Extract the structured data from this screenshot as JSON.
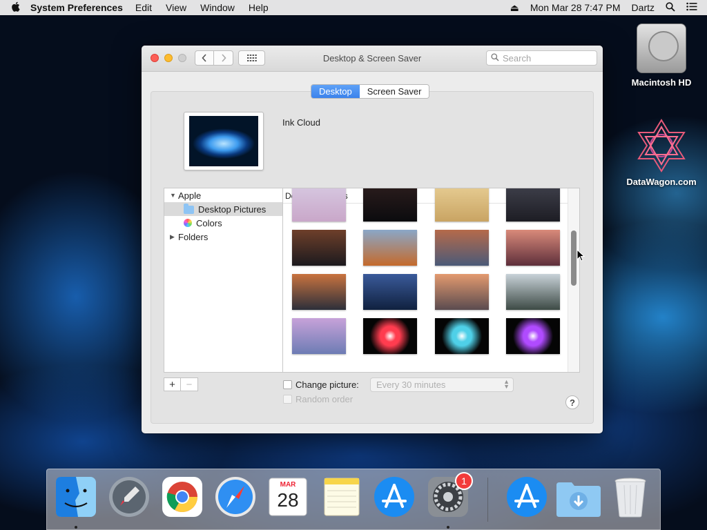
{
  "menubar": {
    "apple": "",
    "app_name": "System Preferences",
    "items": [
      "Edit",
      "View",
      "Window",
      "Help"
    ],
    "eject": "⏏",
    "datetime": "Mon Mar 28  7:47 PM",
    "user": "Dartz"
  },
  "window": {
    "title": "Desktop & Screen Saver",
    "search_placeholder": "Search",
    "tabs": [
      {
        "label": "Desktop",
        "active": true
      },
      {
        "label": "Screen Saver",
        "active": false
      }
    ],
    "current_picture": "Ink Cloud",
    "sources": [
      {
        "label": "Apple",
        "type": "group",
        "expanded": true
      },
      {
        "label": "Desktop Pictures",
        "type": "child",
        "icon": "folder-icon",
        "selected": true
      },
      {
        "label": "Colors",
        "type": "child",
        "icon": "colors-icon"
      },
      {
        "label": "Folders",
        "type": "group",
        "expanded": false
      }
    ],
    "grid_header": "Desktop Pictures",
    "thumbnails": [
      {
        "name": "wallpaper-lake-rock",
        "colors": [
          "#d6c7e0",
          "#c9a7c9"
        ]
      },
      {
        "name": "wallpaper-mono-lake-night",
        "colors": [
          "#2a1c1c",
          "#0b0b0e"
        ]
      },
      {
        "name": "wallpaper-desert-dunes",
        "colors": [
          "#e6cc92",
          "#c9a463"
        ]
      },
      {
        "name": "wallpaper-mojave-dunes",
        "colors": [
          "#3e3f4a",
          "#1d1d24"
        ]
      },
      {
        "name": "wallpaper-sierra-peaks",
        "colors": [
          "#6e3f2a",
          "#1c1a1e"
        ]
      },
      {
        "name": "wallpaper-high-sierra",
        "colors": [
          "#8aa7c7",
          "#c46a2b"
        ]
      },
      {
        "name": "wallpaper-el-capitan-dusk",
        "colors": [
          "#b56a4a",
          "#4b5a78"
        ]
      },
      {
        "name": "wallpaper-sierra-sunset",
        "colors": [
          "#d98a7a",
          "#5e2f3b"
        ]
      },
      {
        "name": "wallpaper-el-capitan",
        "colors": [
          "#c9733f",
          "#2c2f3a"
        ]
      },
      {
        "name": "wallpaper-blue-mountains",
        "colors": [
          "#3a5a9a",
          "#10213f"
        ]
      },
      {
        "name": "wallpaper-half-dome",
        "colors": [
          "#e39a6f",
          "#5a4b4f"
        ]
      },
      {
        "name": "wallpaper-yosemite-forest",
        "colors": [
          "#c8d2d8",
          "#3d4a45"
        ]
      },
      {
        "name": "wallpaper-yosemite-valley",
        "colors": [
          "#c7a2d9",
          "#6d7cb4"
        ]
      },
      {
        "name": "wallpaper-color-burst-red",
        "colors": [
          "#ff3c4f",
          "#050505"
        ]
      },
      {
        "name": "wallpaper-color-burst-blue",
        "colors": [
          "#4fd0e8",
          "#050505"
        ]
      },
      {
        "name": "wallpaper-color-burst-purple",
        "colors": [
          "#b04bff",
          "#050505"
        ]
      }
    ],
    "change_picture_label": "Change picture:",
    "interval_value": "Every 30 minutes",
    "random_order_label": "Random order",
    "help_label": "?"
  },
  "desktop_icons": [
    {
      "label": "Macintosh HD"
    },
    {
      "label": "DataWagon.com"
    }
  ],
  "dock": {
    "badge": "1",
    "calendar_month": "MAR",
    "calendar_day": "28"
  }
}
